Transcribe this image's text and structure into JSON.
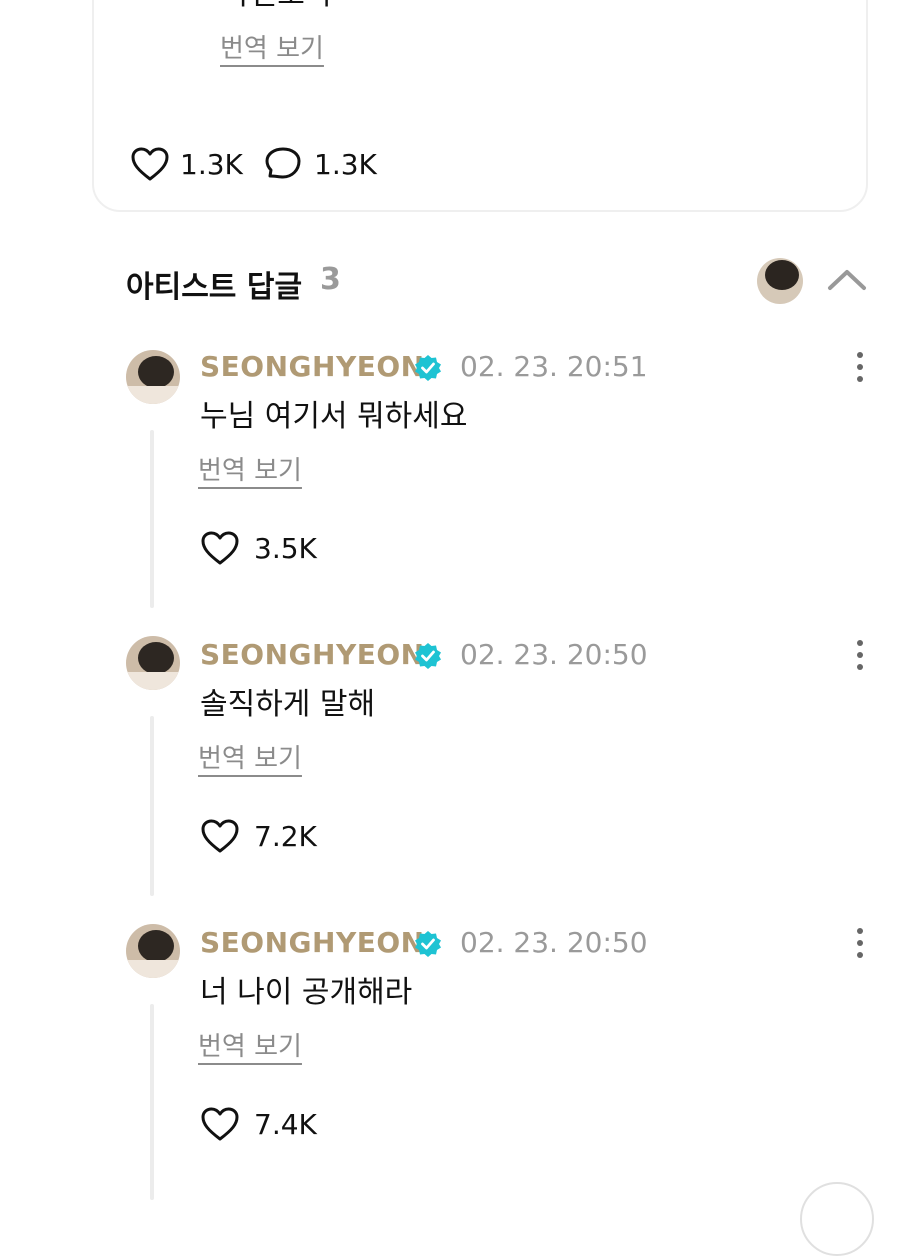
{
  "post": {
    "text": "마틴오빠",
    "translate_label": "번역 보기",
    "likes": "1.3K",
    "comments": "1.3K"
  },
  "artist_replies": {
    "title": "아티스트 답글",
    "count": "3"
  },
  "replies": [
    {
      "author": "SEONGHYEON",
      "timestamp": "02. 23. 20:51",
      "text": "누님 여기서 뭐하세요",
      "translate_label": "번역 보기",
      "likes": "3.5K"
    },
    {
      "author": "SEONGHYEON",
      "timestamp": "02. 23. 20:50",
      "text": "솔직하게 말해",
      "translate_label": "번역 보기",
      "likes": "7.2K"
    },
    {
      "author": "SEONGHYEON",
      "timestamp": "02. 23. 20:50",
      "text": "너 나이 공개해라",
      "translate_label": "번역 보기",
      "likes": "7.4K"
    }
  ],
  "colors": {
    "author": "#b09a74",
    "verified": "#1ec3d3",
    "muted": "#9a9a9a"
  }
}
